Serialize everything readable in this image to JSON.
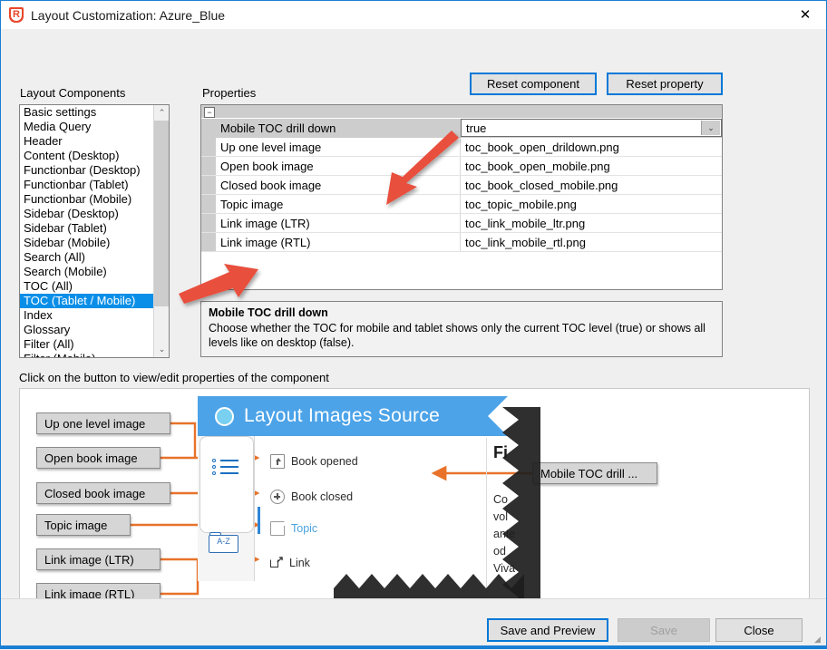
{
  "window": {
    "title": "Layout Customization: Azure_Blue",
    "app_icon": "shield-r-icon",
    "close_icon": "✕",
    "accent_color": "#1a7fd4"
  },
  "toolbar": {
    "reset_component_label": "Reset component",
    "reset_property_label": "Reset property"
  },
  "labels": {
    "layout_components": "Layout Components",
    "properties": "Properties",
    "hint": "Click on the button to view/edit properties of the component"
  },
  "components_list": {
    "items": [
      "Basic settings",
      "Media Query",
      "Header",
      "Content (Desktop)",
      "Functionbar (Desktop)",
      "Functionbar (Tablet)",
      "Functionbar (Mobile)",
      "Sidebar (Desktop)",
      "Sidebar (Tablet)",
      "Sidebar (Mobile)",
      "Search (All)",
      "Search (Mobile)",
      "TOC (All)",
      "TOC (Tablet / Mobile)",
      "Index",
      "Glossary",
      "Filter (All)",
      "Filter (Mobile)"
    ],
    "selected_index": 13,
    "selected_color": "#0a8fe8",
    "scroll_up_icon": "⌃",
    "scroll_down_icon": "⌄"
  },
  "property_grid": {
    "collapse_icon": "−",
    "rows": [
      {
        "name": "Mobile TOC drill down",
        "value": "true",
        "editor": "dropdown"
      },
      {
        "name": "Up one level image",
        "value": "toc_book_open_drildown.png",
        "editor": "text"
      },
      {
        "name": "Open book image",
        "value": "toc_book_open_mobile.png",
        "editor": "text"
      },
      {
        "name": "Closed book image",
        "value": "toc_book_closed_mobile.png",
        "editor": "text"
      },
      {
        "name": "Topic image",
        "value": "toc_topic_mobile.png",
        "editor": "text"
      },
      {
        "name": "Link image (LTR)",
        "value": "toc_link_mobile_ltr.png",
        "editor": "text"
      },
      {
        "name": "Link image (RTL)",
        "value": "toc_link_mobile_rtl.png",
        "editor": "text"
      }
    ],
    "dropdown_icon": "⌄"
  },
  "description": {
    "title": "Mobile TOC drill down",
    "body": "Choose whether the TOC for mobile and tablet shows only the current TOC level (true) or shows all levels like on desktop (false)."
  },
  "preview": {
    "banner_title": "Layout Images Source",
    "banner_color": "#4ca3e8",
    "callout_color": "#E8722A",
    "callouts": [
      {
        "label": "Up one level image"
      },
      {
        "label": "Open book image"
      },
      {
        "label": "Closed book image"
      },
      {
        "label": "Topic image"
      },
      {
        "label": "Link image (LTR)"
      },
      {
        "label": "Link image (RTL)"
      }
    ],
    "right_callout": {
      "label": "Mobile TOC drill ..."
    },
    "toc_entries": [
      {
        "label": "Book opened",
        "icon": "book-opened-icon"
      },
      {
        "label": "Book closed",
        "icon": "book-closed-icon"
      },
      {
        "label": "Topic",
        "icon": "topic-page-icon"
      },
      {
        "label": "Link",
        "icon": "external-link-icon"
      }
    ],
    "glossary_icon_label": "A-Z",
    "body_text": {
      "heading": "Fi",
      "lines": [
        "Co",
        "vol",
        "ante",
        "od",
        "Viva"
      ]
    }
  },
  "footer": {
    "save_preview_label": "Save and Preview",
    "save_label": "Save",
    "close_label": "Close"
  }
}
